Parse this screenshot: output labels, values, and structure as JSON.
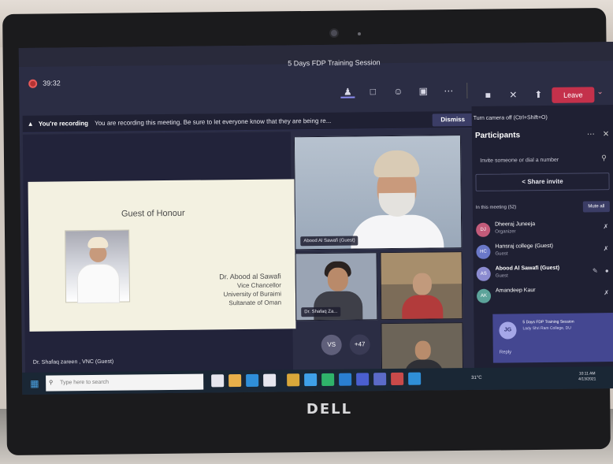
{
  "meeting": {
    "title": "5 Days FDP Training Session",
    "timer": "39:32",
    "leave_label": "Leave"
  },
  "colors": {
    "accent": "#444791",
    "leave": "#c4314b",
    "background": "#292a3b"
  },
  "toolbar": [
    {
      "icon": "people-icon",
      "glyph": "♟"
    },
    {
      "icon": "chat-icon",
      "glyph": "□"
    },
    {
      "icon": "reactions-icon",
      "glyph": "☺"
    },
    {
      "icon": "rooms-icon",
      "glyph": "▣"
    },
    {
      "icon": "more-icon",
      "glyph": "⋯"
    },
    {
      "icon": "camera-icon",
      "glyph": "■"
    },
    {
      "icon": "mic-off-icon",
      "glyph": "✕"
    },
    {
      "icon": "share-icon",
      "glyph": "⬆"
    }
  ],
  "banner": {
    "warning_icon": "▲",
    "heading": "You're recording",
    "message": "You are recording this meeting. Be sure to let everyone know that they are being re...",
    "dismiss_label": "Dismiss"
  },
  "slide": {
    "title": "Guest of Honour",
    "name": "Dr. Abood al Sawafi",
    "lines": [
      "Vice Chancellor",
      "University of Buraimi",
      "Sultanate of Oman"
    ]
  },
  "stage_label": "Dr. Shafaq zareen , VNC (Guest)",
  "tiles": {
    "main_label": "Abood Al Sawafi (Guest)",
    "small_label": "Dr. Shafaq Za...",
    "avatar_initials": "VS",
    "overflow": "+47"
  },
  "panel": {
    "tooltip": "Turn camera off (Ctrl+Shift+O)",
    "title": "Participants",
    "invite_placeholder": "Invite someone or dial a number",
    "share_label": "Share invite",
    "in_meeting": "In this meeting (52)",
    "mute_all": "Mute all",
    "participants": [
      {
        "initials": "DJ",
        "name": "Dheeraj Juneeja",
        "role": "Organizer",
        "color": "#c25b7a"
      },
      {
        "initials": "HC",
        "name": "Hansraj college (Guest)",
        "role": "Guest",
        "color": "#6a78c8"
      },
      {
        "initials": "AS",
        "name": "Abood Al Sawafi (Guest)",
        "role": "Guest",
        "color": "#8b8bd0"
      },
      {
        "initials": "AK",
        "name": "Amandeep Kaur",
        "role": "",
        "color": "#5ca39a"
      }
    ]
  },
  "chat_toast": {
    "initials": "JG",
    "title": "5 Days FDP Training Session",
    "subtitle": "Lady Shri Ram College, DU",
    "reply": "Reply"
  },
  "taskbar": {
    "search_placeholder": "Type here to search",
    "weather": "31°C",
    "time": "10:11 AM",
    "date": "4/13/2021"
  }
}
